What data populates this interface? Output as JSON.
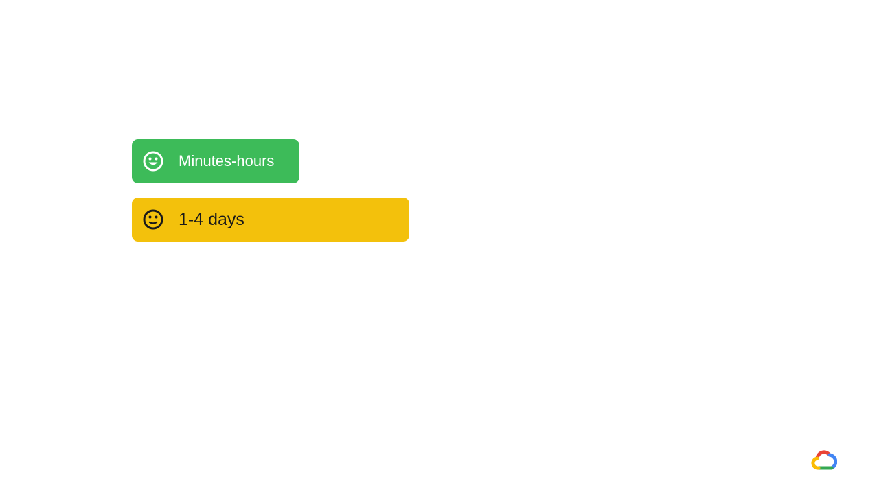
{
  "items": [
    {
      "label": "Minutes-hours",
      "icon": "smiling-face-icon",
      "background": "#3DBB59",
      "text_color": "#ffffff"
    },
    {
      "label": "1-4 days",
      "icon": "neutral-face-icon",
      "background": "#F3C10C",
      "text_color": "#1a1a1a"
    }
  ],
  "logo": {
    "icon": "google-cloud-logo",
    "colors": [
      "#EA4335",
      "#4285F4",
      "#34A853",
      "#FBBC04"
    ]
  }
}
